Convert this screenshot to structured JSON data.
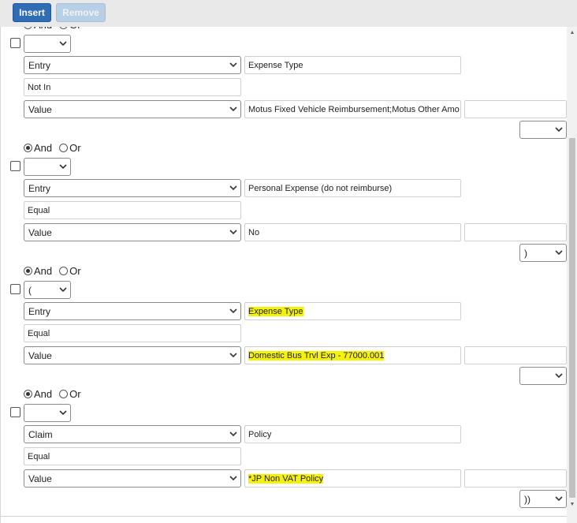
{
  "toolbar": {
    "insert_label": "Insert",
    "remove_label": "Remove"
  },
  "radio": {
    "and_label": "And",
    "or_label": "Or"
  },
  "groups": [
    {
      "and_selected": true,
      "paren": "",
      "field1": {
        "select": "Entry",
        "value": "Expense Type"
      },
      "operator": "Not In",
      "field2": {
        "select": "Value",
        "value": "Motus Fixed Vehicle Reimbursement;Motus Other Amo",
        "extra": ""
      },
      "logic": ""
    },
    {
      "and_selected": true,
      "paren": "",
      "field1": {
        "select": "Entry",
        "value": "Personal Expense  (do not reimburse)"
      },
      "operator": "Equal",
      "field2": {
        "select": "Value",
        "value": "No",
        "extra": ""
      },
      "logic": ")"
    },
    {
      "and_selected": true,
      "paren": "(",
      "field1": {
        "select": "Entry",
        "value": "Expense Type"
      },
      "operator": "Equal",
      "field2": {
        "select": "Value",
        "value": "Domestic Bus Trvl Exp - 77000.001",
        "extra": ""
      },
      "logic": ""
    },
    {
      "and_selected": true,
      "paren": "",
      "field1": {
        "select": "Claim",
        "value": "Policy"
      },
      "operator": "Equal",
      "field2": {
        "select": "Value",
        "value": "*JP Non VAT  Policy",
        "extra": ""
      },
      "logic": "))"
    }
  ],
  "colors": {
    "highlight": "#f5f20a",
    "insert_button": "#2f6db5",
    "remove_button": "#b9cfe6"
  }
}
